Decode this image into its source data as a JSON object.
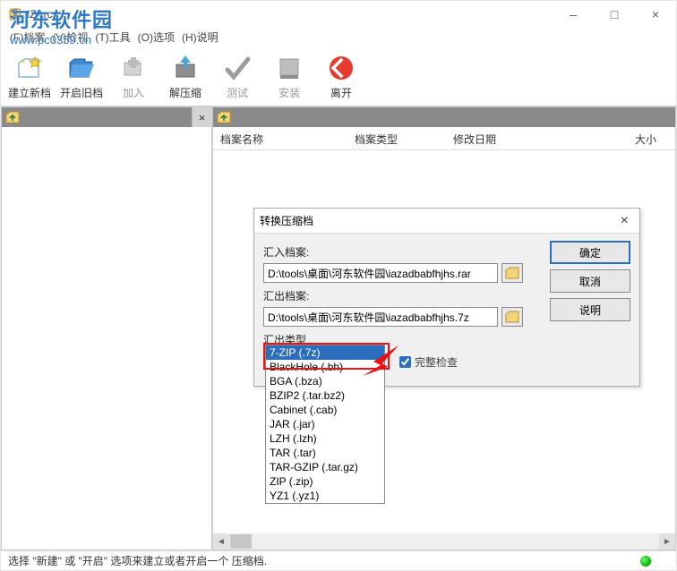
{
  "window": {
    "title": "IZArc"
  },
  "winbuttons": {
    "min": "–",
    "max": "□",
    "close": "×"
  },
  "menu": {
    "file": "(F)档案",
    "view": "(V)检视",
    "tool": "(T)工具",
    "option": "(O)选项",
    "help": "(H)说明"
  },
  "toolbar": {
    "new_label": "建立新档",
    "open_label": "开启旧档",
    "add_label": "加入",
    "extract_label": "解压缩",
    "test_label": "测试",
    "install_label": "安装",
    "exit_label": "离开"
  },
  "columns": {
    "name": "档案名称",
    "type": "档案类型",
    "date": "修改日期",
    "size": "大小"
  },
  "leftpane": {
    "close": "×"
  },
  "dialog": {
    "title": "转换压缩档",
    "close": "×",
    "import_label": "汇入档案:",
    "import_value": "D:\\tools\\桌面\\河东软件园\\iazadbabfhjhs.rar",
    "export_label": "汇出档案:",
    "export_value": "D:\\tools\\桌面\\河东软件园\\iazadbabfhjhs.7z",
    "type_label": "汇出类型",
    "combo_value": "7-ZIP (.7z)",
    "check_label": "完整检查",
    "ok": "确定",
    "cancel": "取消",
    "help": "说明",
    "options": [
      "7-ZIP (.7z)",
      "BlackHole (.bh)",
      "BGA (.bza)",
      "BZIP2 (.tar.bz2)",
      "Cabinet (.cab)",
      "JAR (.jar)",
      "LZH (.lzh)",
      "TAR (.tar)",
      "TAR-GZIP (.tar.gz)",
      "ZIP (.zip)",
      "YZ1 (.yz1)"
    ]
  },
  "status": {
    "text": "选择 \"新建\" 或 \"开启\" 选项来建立或者开启一个 压缩档."
  },
  "watermark": {
    "line1": "河东软件园",
    "line2": "www.pc0359.cn"
  },
  "scroll": {
    "left": "◄",
    "right": "►"
  }
}
